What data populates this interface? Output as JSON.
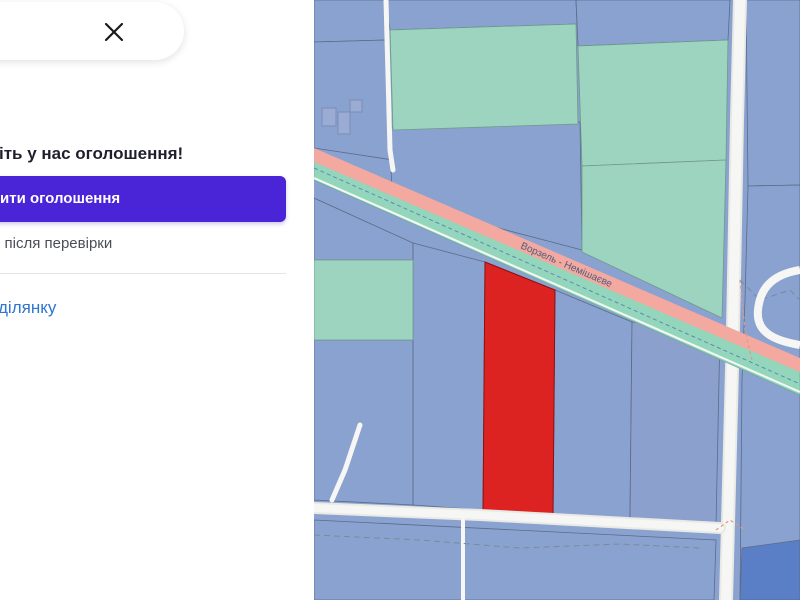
{
  "panel": {
    "close_icon": "close-icon",
    "heading": "іть у нас оголошення!",
    "cta_label": "ити оголошення",
    "note": "і після перевірки",
    "link": "ділянку"
  },
  "map": {
    "road_label": "Ворзель - Немішаєве",
    "colors": {
      "parcel": "#8aa2cf",
      "field": "#9dd4bf",
      "selected_parcel": "#dd2222",
      "road": "#f0f0ee",
      "railway_buffer": "#93d6bc",
      "railway_edge": "#f3a8a0",
      "accent": "#4a25d8"
    }
  }
}
